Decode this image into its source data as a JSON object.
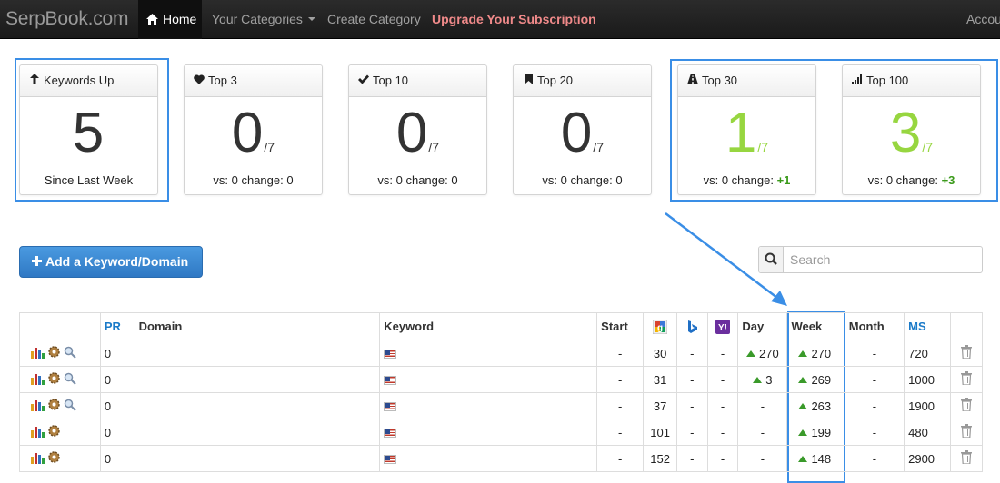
{
  "navbar": {
    "brand": "SerpBook.com",
    "home": "Home",
    "categories": "Your Categories",
    "create": "Create Category",
    "upgrade": "Upgrade Your Subscription",
    "account": "Accou"
  },
  "cards": [
    {
      "icon": "arrow-up-icon",
      "title": "Keywords Up",
      "value": "5",
      "of": "",
      "foot": "Since Last Week",
      "change": ""
    },
    {
      "icon": "heart-icon",
      "title": "Top 3",
      "value": "0",
      "of": "/7",
      "foot": "vs: 0 change: 0",
      "change": ""
    },
    {
      "icon": "check-icon",
      "title": "Top 10",
      "value": "0",
      "of": "/7",
      "foot": "vs: 0 change: 0",
      "change": ""
    },
    {
      "icon": "bookmark-icon",
      "title": "Top 20",
      "value": "0",
      "of": "/7",
      "foot": "vs: 0 change: 0",
      "change": ""
    },
    {
      "icon": "road-icon",
      "title": "Top 30",
      "value": "1",
      "of": "/7",
      "foot": "vs: 0 change: ",
      "change": "+1"
    },
    {
      "icon": "signal-icon",
      "title": "Top 100",
      "value": "3",
      "of": "/7",
      "foot": "vs: 0 change: ",
      "change": "+3"
    }
  ],
  "add_button": "Add a Keyword/Domain",
  "search": {
    "placeholder": "Search"
  },
  "table": {
    "headers": {
      "pr": "PR",
      "domain": "Domain",
      "keyword": "Keyword",
      "start": "Start",
      "day": "Day",
      "week": "Week",
      "month": "Month",
      "ms": "MS"
    },
    "rows": [
      {
        "pr": "0",
        "start": "-",
        "google": "30",
        "bing": "-",
        "yahoo": "-",
        "day": "270",
        "day_up": true,
        "week": "270",
        "month": "-",
        "ms": "720",
        "search_tool": true
      },
      {
        "pr": "0",
        "start": "-",
        "google": "31",
        "bing": "-",
        "yahoo": "-",
        "day": "3",
        "day_up": true,
        "week": "269",
        "month": "-",
        "ms": "1000",
        "search_tool": true
      },
      {
        "pr": "0",
        "start": "-",
        "google": "37",
        "bing": "-",
        "yahoo": "-",
        "day": "-",
        "day_up": false,
        "week": "263",
        "month": "-",
        "ms": "1900",
        "search_tool": true
      },
      {
        "pr": "0",
        "start": "-",
        "google": "101",
        "bing": "-",
        "yahoo": "-",
        "day": "-",
        "day_up": false,
        "week": "199",
        "month": "-",
        "ms": "480",
        "search_tool": false
      },
      {
        "pr": "0",
        "start": "-",
        "google": "152",
        "bing": "-",
        "yahoo": "-",
        "day": "-",
        "day_up": false,
        "week": "148",
        "month": "-",
        "ms": "2900",
        "search_tool": false
      }
    ]
  },
  "accent": "#3a8ee6",
  "green": "#97d640"
}
